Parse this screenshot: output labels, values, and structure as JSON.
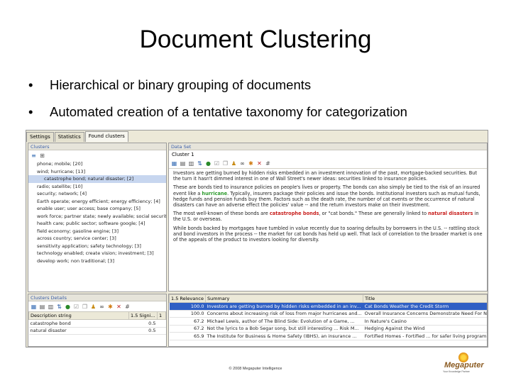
{
  "slide": {
    "title": "Document Clustering",
    "bullet_symbol": "•",
    "bullets": [
      "Hierarchical or binary grouping of documents",
      "Automated creation of a tentative taxonomy for categorization"
    ],
    "footer": "© 2008 Megaputer Intelligence",
    "logo_text": "Megaputer",
    "logo_tagline": "Your Knowledge Partner"
  },
  "app": {
    "tabs": [
      "Settings",
      "Statistics",
      "Found clusters"
    ],
    "active_tab": "Found clusters",
    "clusters_panel": {
      "title": "Clusters",
      "items": [
        "phone; mobile; [20]",
        "wind; hurricane; [13]",
        "catastrophe bond; natural disaster; [2]",
        "radio; satellite; [10]",
        "security; network; [4]",
        "Earth operate; energy efficient; energy efficiency; [4]",
        "enable user; user access; base company; [5]",
        "work force; partner state; newly available; social securit",
        "health care; public sector; software google; [4]",
        "field economy; gasoline engine; [3]",
        "across country; service center; [3]",
        "sensitivity application; safety technology; [3]",
        "technology enabled; create vision; investment; [3]",
        "develop work; non traditional; [3]"
      ],
      "selected_index": 2
    },
    "clusters_details": {
      "title": "Clusters Details",
      "headers": [
        "Description string",
        "1.5 Signi...",
        "1"
      ],
      "rows": [
        [
          "catastrophe bond",
          "0.5"
        ],
        [
          "natural disaster",
          "0.5"
        ]
      ]
    },
    "data_panel": {
      "title": "Data Set",
      "cluster_label": "Cluster 1",
      "paragraphs": [
        [
          {
            "t": "Investors are getting burned by hidden risks embedded in an investment innovation of the past, mortgage-backed securities. But the turn it hasn't dimmed interest in one of Wall Street's newer ideas: securities linked to insurance policies.",
            "c": ""
          }
        ],
        [
          {
            "t": "These are bonds tied to insurance policies on people's lives or property. The bonds can also simply be tied to the risk of an insured event like a ",
            "c": ""
          },
          {
            "t": "hurricane",
            "c": "green"
          },
          {
            "t": ". Typically, insurers package their policies and issue the bonds. Institutional investors such as mutual funds, hedge funds and pension funds buy them. Factors such as the death rate, the number of cat events or the occurrence of natural disasters can have an adverse effect the policies' value -- and the return investors make on their investment.",
            "c": ""
          }
        ],
        [
          {
            "t": "The most well-known of these bonds are ",
            "c": ""
          },
          {
            "t": "catastrophe bonds",
            "c": "red"
          },
          {
            "t": ", or \"cat bonds.\" These are generally linked to ",
            "c": ""
          },
          {
            "t": "natural disasters",
            "c": "red"
          },
          {
            "t": " in the U.S. or overseas.",
            "c": ""
          }
        ],
        [
          {
            "t": "While bonds backed by mortgages have tumbled in value recently due to soaring defaults by borrowers in the U.S. -- rattling stock and bond investors in the process -- the market for cat bonds has held up well. That lack of correlation to the broader market is one of the appeals of the product to investors looking for diversity.",
            "c": ""
          }
        ]
      ]
    },
    "results_table": {
      "headers": [
        "1.5 Relevance",
        "Summary",
        "Title"
      ],
      "rows": [
        [
          "100.0",
          "Investors are getting burned by hidden risks embedded in an inv...",
          "Cat Bonds Weather the Credit Storm"
        ],
        [
          "100.0",
          "Concerns about increasing risk of loss from major hurricanes and...",
          "Overall Insurance Concerns Demonstrate Need For New Catastr..."
        ],
        [
          "67.2",
          "Michael Lewis, author of The Blind Side: Evolution of a Game, ...",
          "In Nature's Casino"
        ],
        [
          "67.2",
          "Not the lyrics to a Bob Segar song, but still interesting ... Risk M...",
          "Hedging Against the Wind"
        ],
        [
          "65.9",
          "The Institute for Business & Home Safety (IBHS), an insurance ...",
          "Fortified Homes - Fortified ... for safer living program"
        ]
      ],
      "selected_index": 0
    },
    "toolbar_icons": [
      "tree-icon",
      "table-icon",
      "chart-icon",
      "sort-icon",
      "globe-icon",
      "check-icon",
      "copy-icon",
      "user-icon",
      "binoculars-icon",
      "refresh-icon",
      "delete-icon",
      "options-icon"
    ]
  }
}
